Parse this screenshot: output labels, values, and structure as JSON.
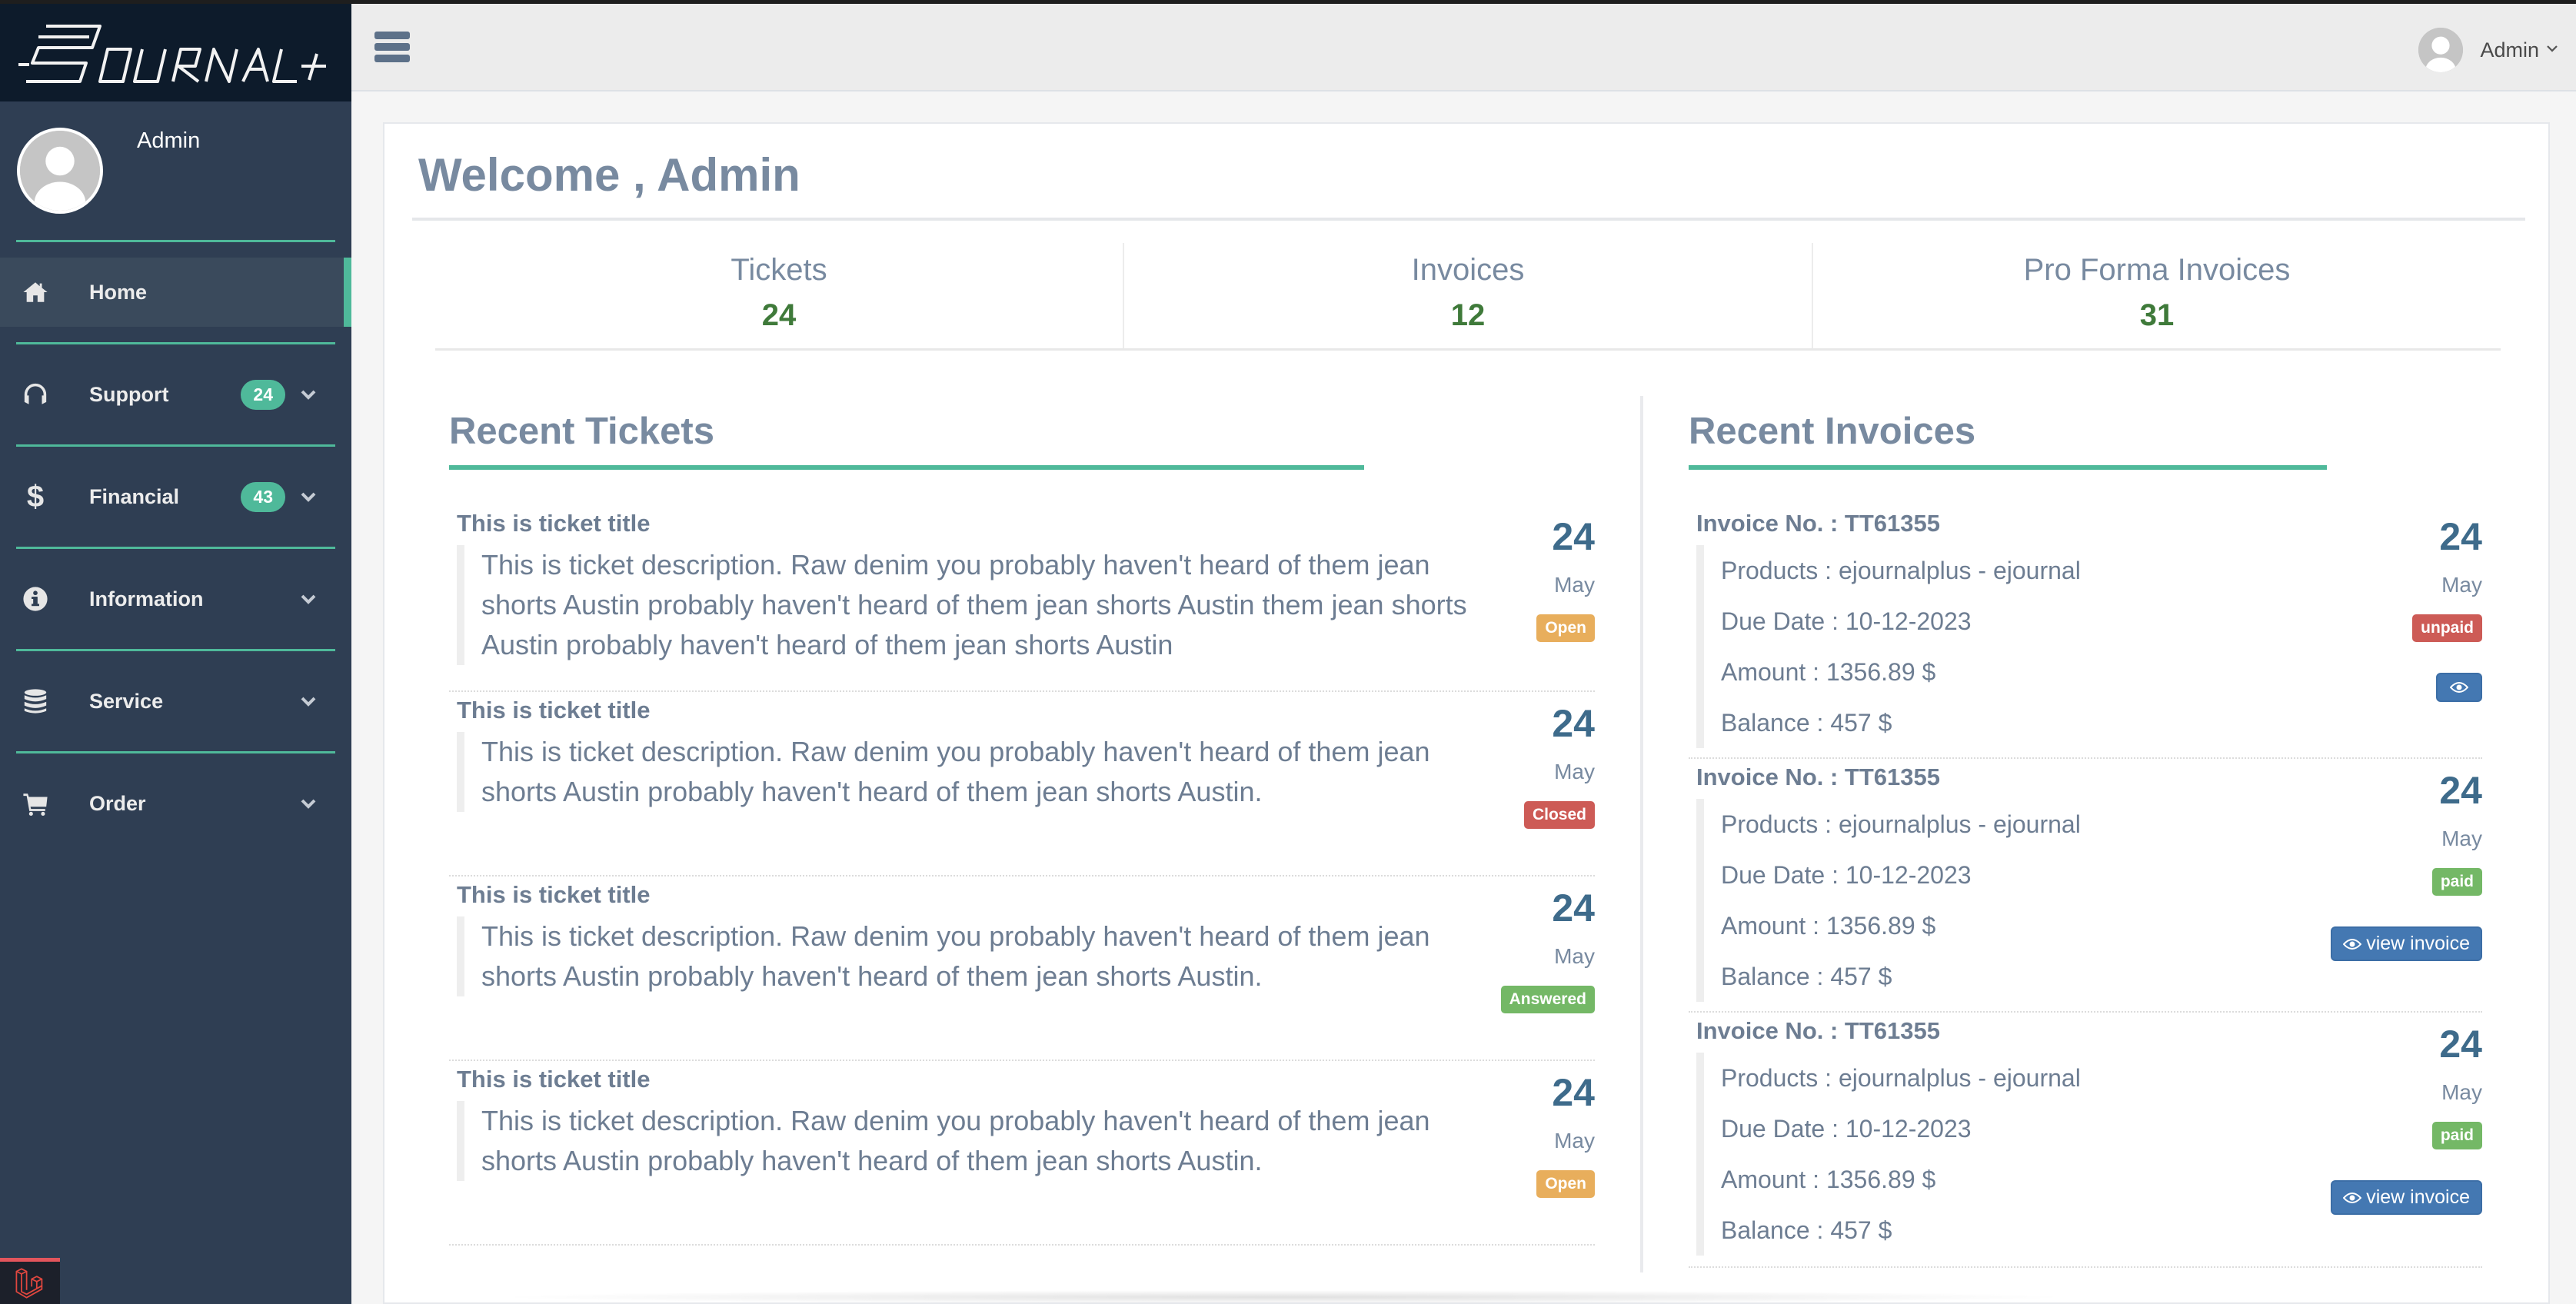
{
  "brand": {
    "logo_text": "EJOURNAL+"
  },
  "sidebar": {
    "user_name": "Admin",
    "items": [
      {
        "label": "Home",
        "icon": "home-icon",
        "active": true
      },
      {
        "label": "Support",
        "icon": "headset-icon",
        "badge": "24"
      },
      {
        "label": "Financial",
        "icon": "dollar-icon",
        "badge": "43"
      },
      {
        "label": "Information",
        "icon": "info-icon"
      },
      {
        "label": "Service",
        "icon": "database-icon"
      },
      {
        "label": "Order",
        "icon": "cart-icon"
      }
    ]
  },
  "topbar": {
    "user_name": "Admin"
  },
  "main": {
    "welcome": "Welcome , Admin",
    "stats": [
      {
        "label": "Tickets",
        "value": "24"
      },
      {
        "label": "Invoices",
        "value": "12"
      },
      {
        "label": "Pro Forma Invoices",
        "value": "31"
      }
    ],
    "recent_tickets": {
      "title": "Recent Tickets",
      "items": [
        {
          "title": "This is ticket title",
          "description": "This is ticket description. Raw denim you probably haven't heard of them jean shorts Austin probably haven't heard of them jean shorts Austin them jean shorts Austin probably haven't heard of them jean shorts Austin",
          "day": "24",
          "month": "May",
          "status": "Open"
        },
        {
          "title": "This is ticket title",
          "description": "This is ticket description. Raw denim you probably haven't heard of them jean shorts Austin probably haven't heard of them jean shorts Austin.",
          "day": "24",
          "month": "May",
          "status": "Closed"
        },
        {
          "title": "This is ticket title",
          "description": "This is ticket description. Raw denim you probably haven't heard of them jean shorts Austin probably haven't heard of them jean shorts Austin.",
          "day": "24",
          "month": "May",
          "status": "Answered"
        },
        {
          "title": "This is ticket title",
          "description": "This is ticket description. Raw denim you probably haven't heard of them jean shorts Austin probably haven't heard of them jean shorts Austin.",
          "day": "24",
          "month": "May",
          "status": "Open"
        }
      ]
    },
    "recent_invoices": {
      "title": "Recent Invoices",
      "items": [
        {
          "number": "Invoice No. : TT61355",
          "products": "Products : ejournalplus - ejournal",
          "due_date": "Due Date : 10-12-2023",
          "amount": "Amount : 1356.89 $",
          "balance": "Balance : 457 $",
          "day": "24",
          "month": "May",
          "status": "unpaid",
          "button_label": ""
        },
        {
          "number": "Invoice No. : TT61355",
          "products": "Products : ejournalplus - ejournal",
          "due_date": "Due Date : 10-12-2023",
          "amount": "Amount : 1356.89 $",
          "balance": "Balance : 457 $",
          "day": "24",
          "month": "May",
          "status": "paid",
          "button_label": "view invoice"
        },
        {
          "number": "Invoice No. : TT61355",
          "products": "Products : ejournalplus - ejournal",
          "due_date": "Due Date : 10-12-2023",
          "amount": "Amount : 1356.89 $",
          "balance": "Balance : 457 $",
          "day": "24",
          "month": "May",
          "status": "paid",
          "button_label": "view invoice"
        }
      ]
    }
  },
  "colors": {
    "accent": "#4fb99a",
    "sidebar_bg": "#2f3e53",
    "open": "#e8ae5c",
    "closed": "#cd5b56",
    "answered": "#74b866",
    "primary_button": "#4478b2",
    "stat_value": "#3f7a3a"
  }
}
